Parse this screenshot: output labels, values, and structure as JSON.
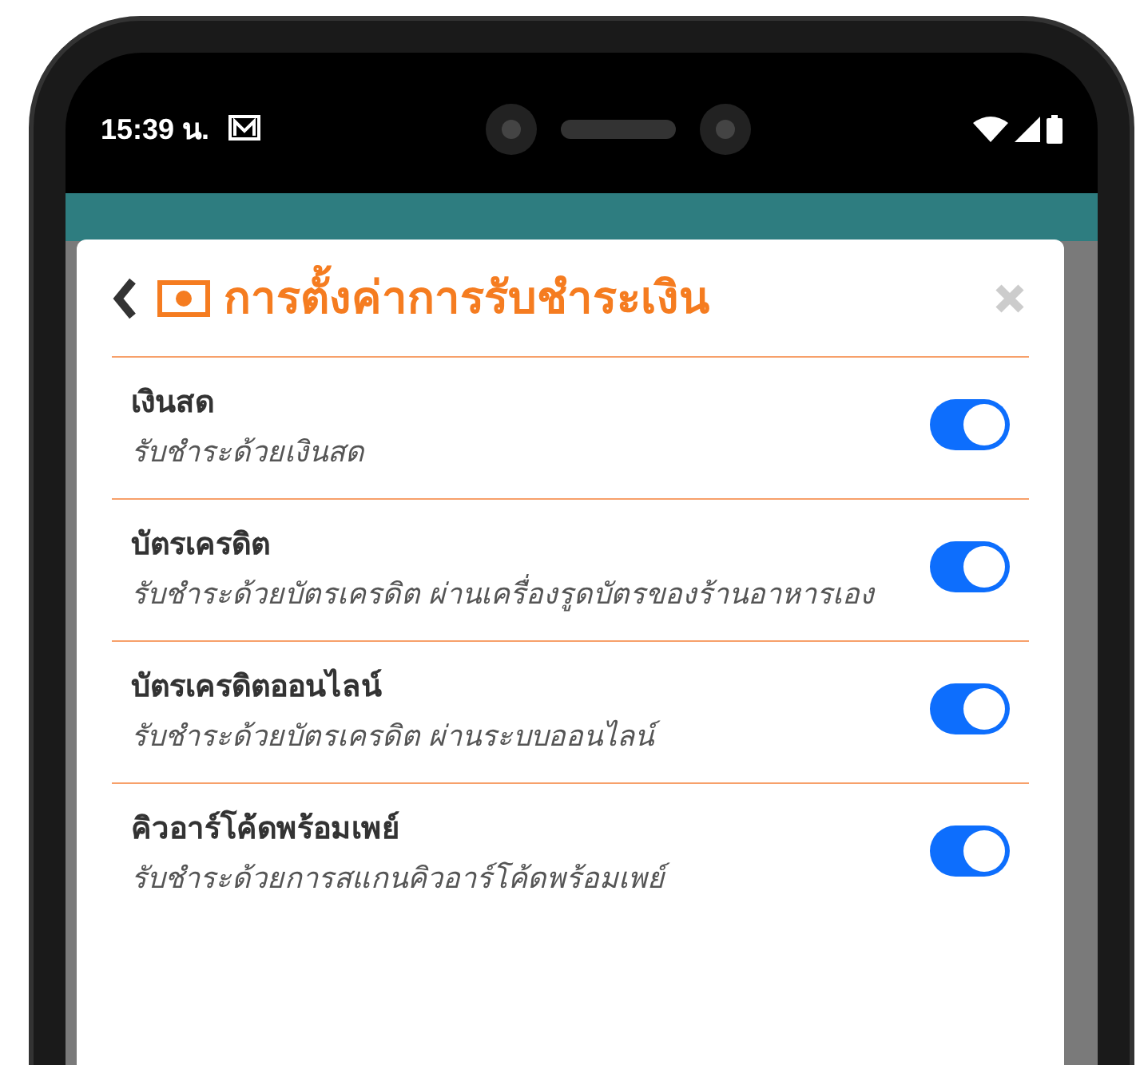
{
  "status_bar": {
    "time": "15:39 น."
  },
  "dialog": {
    "title": "การตั้งค่าการรับชำระเงิน"
  },
  "payment_methods": [
    {
      "name": "เงินสด",
      "description": "รับชำระด้วยเงินสด",
      "on": true
    },
    {
      "name": "บัตรเครดิต",
      "description": "รับชำระด้วยบัตรเครดิต ผ่านเครื่องรูดบัตรของร้านอาหารเอง",
      "on": true
    },
    {
      "name": "บัตรเครดิตออนไลน์",
      "description": "รับชำระด้วยบัตรเครดิต ผ่านระบบออนไลน์",
      "on": true
    },
    {
      "name": "คิวอาร์โค้ดพร้อมเพย์",
      "description": "รับชำระด้วยการสแกนคิวอาร์โค้ดพร้อมเพย์",
      "on": true
    }
  ]
}
